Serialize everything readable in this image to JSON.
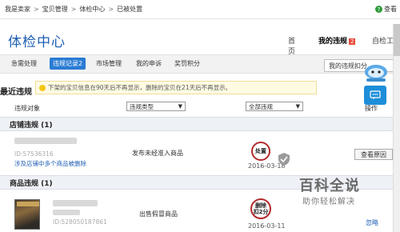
{
  "breadcrumb": [
    "我是卖家",
    "宝贝管理",
    "体检中心",
    "已被处置"
  ],
  "help_label": "查看",
  "page_title": "体检中心",
  "main_nav": {
    "home": "首页",
    "mine": "我的违规",
    "mine_badge": "2",
    "self": "自检工"
  },
  "tabs": [
    "急需处理",
    "违规记录2",
    "市场管理",
    "我的申诉",
    "奖罚积分"
  ],
  "rules_button": "我的违规扣分",
  "recent_label": "最近违规",
  "notice": "下架的宝贝信息在90天后不再显示，删除的宝贝在21天后不再显示。",
  "filter": {
    "label": "违规对象",
    "type_select": "违规类型",
    "all_select": "全部违规",
    "op_label": "操作"
  },
  "sections": {
    "store": {
      "title": "店铺违规 (1)",
      "id": "ID:57536316",
      "link": "涉及店铺中多个商品被删除",
      "reason": "发布未经准入商品",
      "stamp": "处置",
      "date": "2016-03-18",
      "button": "查看原因"
    },
    "goods": {
      "title": "商品违规 (1)",
      "id": "ID:528050187861",
      "reason": "出售假冒商品",
      "stamp_line1": "删除",
      "stamp_line2": "扣2分",
      "date": "2016-03-11",
      "ignore": "忽略"
    }
  },
  "watermark": {
    "big": "百科全说",
    "small": "助你轻松解决"
  },
  "colors": {
    "brand_blue": "#1f5fb3",
    "tab_active": "#2a7bd4",
    "stamp_red": "#b32b2b"
  }
}
